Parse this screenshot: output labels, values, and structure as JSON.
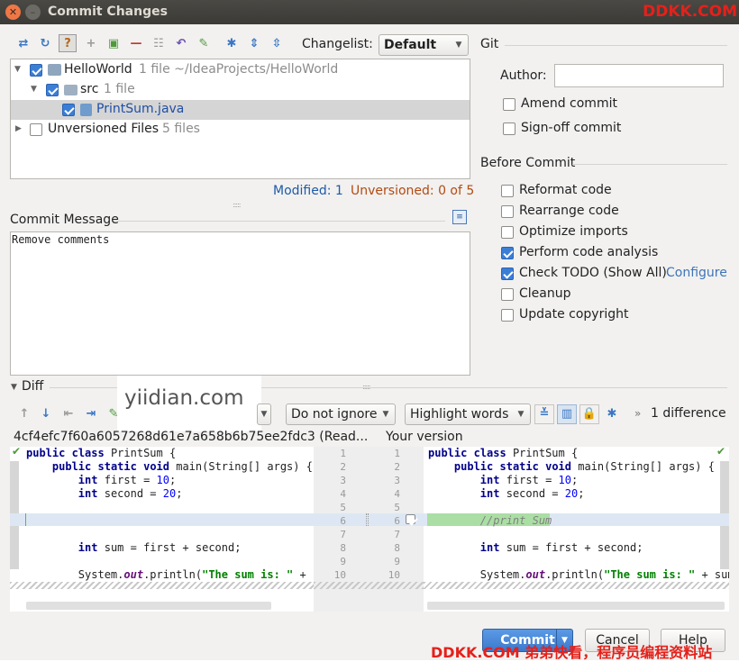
{
  "window": {
    "title": "Commit Changes"
  },
  "watermarks": {
    "top": "DDKK.COM",
    "bottom": "DDKK.COM 弟弟快看，程序员编程资料站",
    "center": "yiidian.com"
  },
  "changes_toolbar": {
    "changelist_label": "Changelist:",
    "changelist_value": "Default"
  },
  "tree": {
    "root": {
      "label": "HelloWorld",
      "info": "1 file  ~/IdeaProjects/HelloWorld"
    },
    "src": {
      "label": "src",
      "info": "1 file"
    },
    "file": {
      "label": "PrintSum.java"
    },
    "unversioned": {
      "label": "Unversioned Files",
      "info": "5 files"
    }
  },
  "status": {
    "modified": "Modified: 1",
    "unversioned": "Unversioned: 0 of 5"
  },
  "commit_message": {
    "label": "Commit Message",
    "value": "Remove comments"
  },
  "git": {
    "header": "Git",
    "author_label": "Author:",
    "author_value": "",
    "amend_commit": "Amend commit",
    "signoff_commit": "Sign-off commit"
  },
  "before_commit": {
    "header": "Before Commit",
    "options": [
      {
        "label": "Reformat code",
        "checked": false
      },
      {
        "label": "Rearrange code",
        "checked": false
      },
      {
        "label": "Optimize imports",
        "checked": false
      },
      {
        "label": "Perform code analysis",
        "checked": true
      },
      {
        "label": "Check TODO (Show All)",
        "checked": true,
        "link": "Configure"
      },
      {
        "label": "Cleanup",
        "checked": false
      },
      {
        "label": "Update copyright",
        "checked": false
      }
    ]
  },
  "diff": {
    "header": "Diff",
    "ignore_value": "Do not ignore",
    "highlight_value": "Highlight words",
    "difference_count": "1 difference",
    "left_title": "4cf4efc7f60a6057268d61e7a658b6b75ee2fdc3 (Read...",
    "right_title": "Your version",
    "left_line_numbers": [
      "1",
      "2",
      "3",
      "4",
      "5",
      "6",
      "7",
      "8",
      "9",
      "10"
    ],
    "right_line_numbers": [
      "1",
      "2",
      "3",
      "4",
      "5",
      "6",
      "7",
      "8",
      "9",
      "10"
    ],
    "code": {
      "public": "public",
      "class": "class",
      "class_name": "PrintSum {",
      "static": "static",
      "void": "void",
      "main_sig": "main(String[] args) {",
      "int": "int",
      "first": "first = ",
      "first_val": "10",
      "second": "second = ",
      "second_val": "20",
      "semi": ";",
      "sum_line": "sum = first + second;",
      "sysout_a": "System.",
      "out": "out",
      "println": ".println(",
      "str": "\"The sum is: \"",
      "plus_s": " + s",
      "plus_sum": " + sum)",
      "comment": "//print Sum"
    }
  },
  "buttons": {
    "commit": "Commit",
    "cancel": "Cancel",
    "help": "Help"
  }
}
